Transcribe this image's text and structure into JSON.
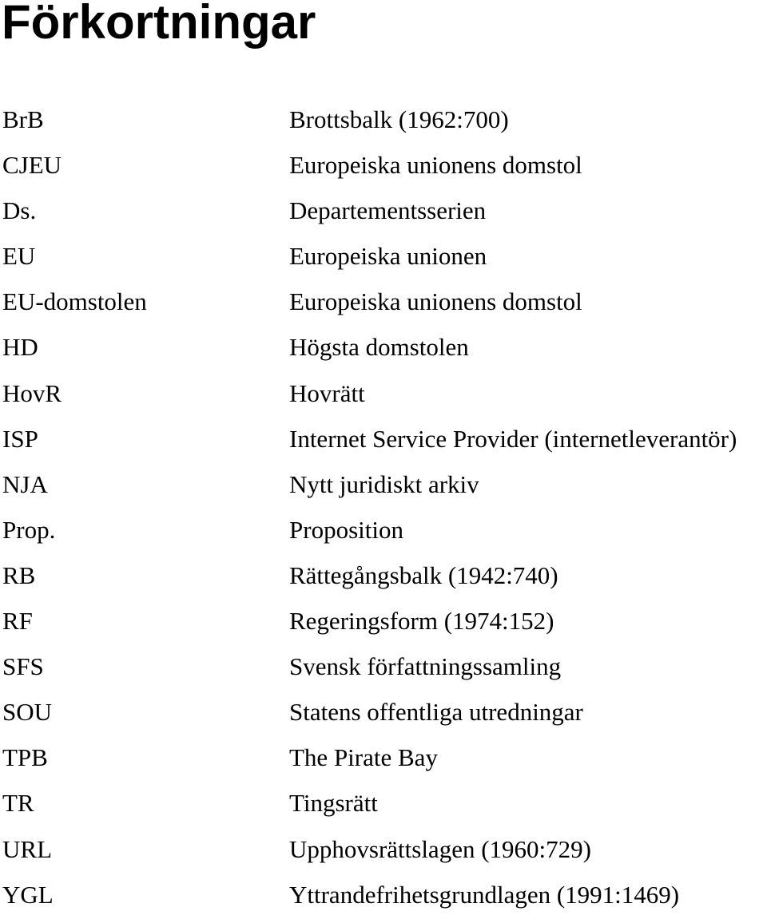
{
  "title": "Förkortningar",
  "entries": [
    {
      "abbr": "BrB",
      "full": "Brottsbalk (1962:700)"
    },
    {
      "abbr": "CJEU",
      "full": "Europeiska unionens domstol"
    },
    {
      "abbr": "Ds.",
      "full": "Departementsserien"
    },
    {
      "abbr": "EU",
      "full": "Europeiska unionen"
    },
    {
      "abbr": "EU-domstolen",
      "full": "Europeiska unionens domstol"
    },
    {
      "abbr": "HD",
      "full": "Högsta domstolen"
    },
    {
      "abbr": "HovR",
      "full": "Hovrätt"
    },
    {
      "abbr": "ISP",
      "full": "Internet Service Provider (internetleverantör)"
    },
    {
      "abbr": "NJA",
      "full": "Nytt juridiskt arkiv"
    },
    {
      "abbr": "Prop.",
      "full": "Proposition"
    },
    {
      "abbr": "RB",
      "full": "Rättegångsbalk (1942:740)"
    },
    {
      "abbr": "RF",
      "full": "Regeringsform (1974:152)"
    },
    {
      "abbr": "SFS",
      "full": "Svensk författningssamling"
    },
    {
      "abbr": "SOU",
      "full": "Statens offentliga utredningar"
    },
    {
      "abbr": "TPB",
      "full": "The Pirate Bay"
    },
    {
      "abbr": "TR",
      "full": "Tingsrätt"
    },
    {
      "abbr": "URL",
      "full": "Upphovsrättslagen (1960:729)"
    },
    {
      "abbr": "YGL",
      "full": "Yttrandefrihetsgrundlagen (1991:1469)"
    }
  ]
}
